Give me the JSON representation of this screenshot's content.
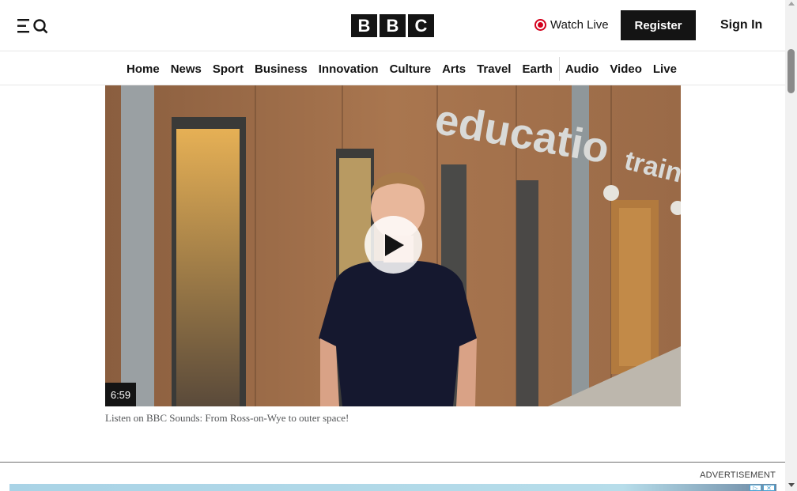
{
  "header": {
    "logo_letters": [
      "B",
      "B",
      "C"
    ],
    "watch_live_label": "Watch Live",
    "register_label": "Register",
    "sign_in_label": "Sign In"
  },
  "nav": {
    "items": [
      "Home",
      "News",
      "Sport",
      "Business",
      "Innovation",
      "Culture",
      "Arts",
      "Travel",
      "Earth",
      "Audio",
      "Video",
      "Live"
    ]
  },
  "video": {
    "duration": "6:59",
    "caption": "Listen on BBC Sounds: From Ross-on-Wye to outer space!",
    "sign_text": "education training ce"
  },
  "ad": {
    "label": "ADVERTISEMENT"
  },
  "colors": {
    "live_red": "#d4001c",
    "black": "#141414",
    "caption_grey": "#545658"
  }
}
